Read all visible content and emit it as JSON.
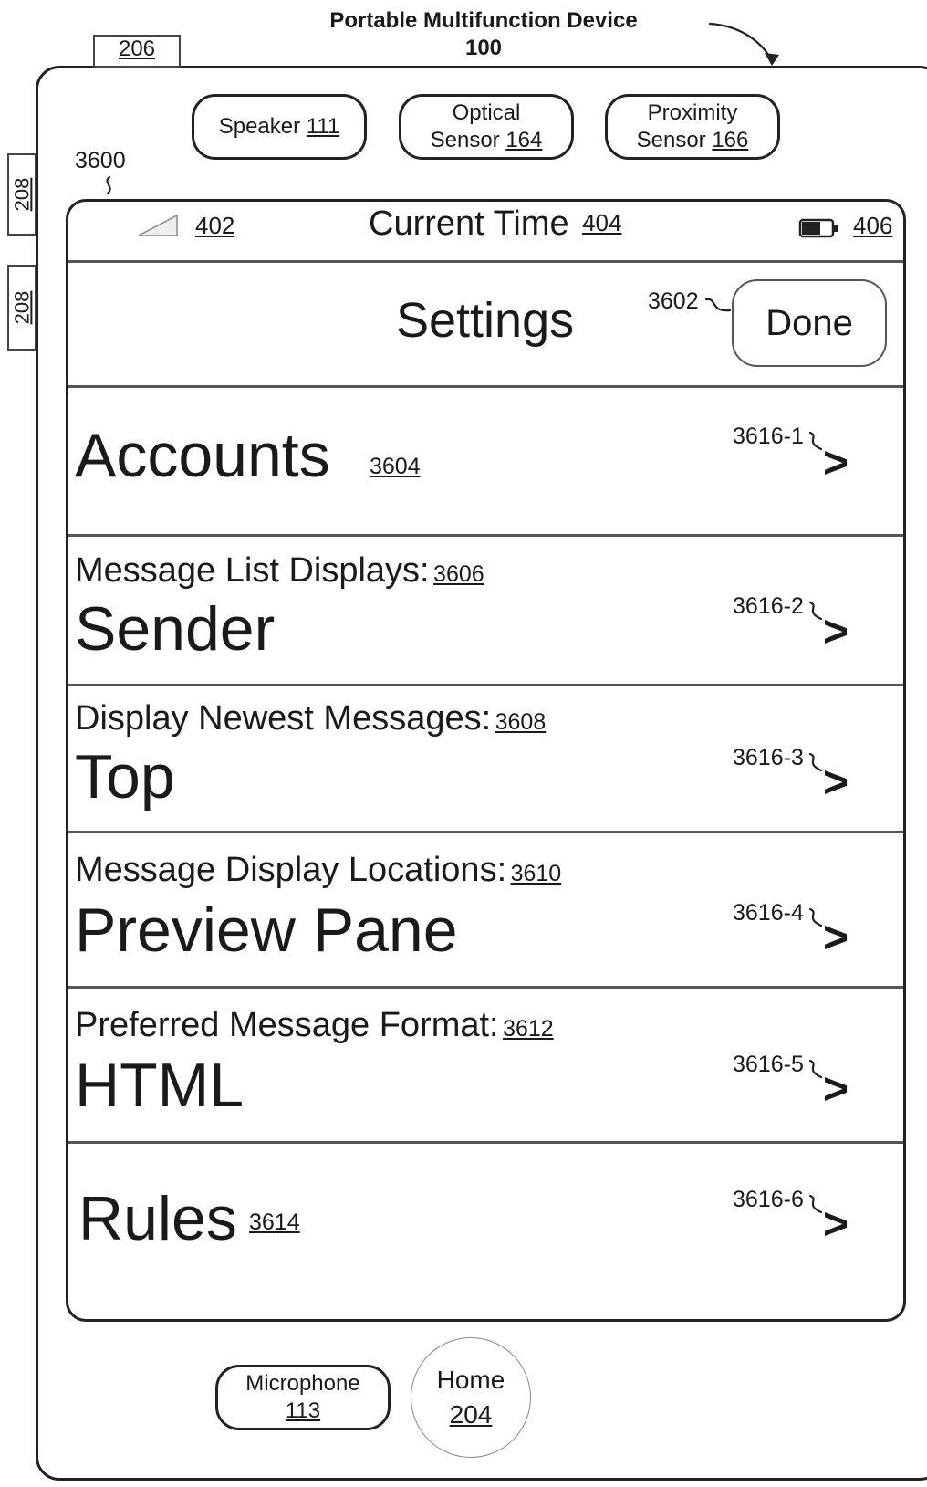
{
  "figure": {
    "title": "Portable Multifunction Device",
    "number": "100",
    "screen_ref": "3600"
  },
  "side_refs": [
    "206",
    "208",
    "208"
  ],
  "hardware": {
    "speaker": {
      "label": "Speaker",
      "ref": "111"
    },
    "optical": {
      "line1": "Optical",
      "label": "Sensor",
      "ref": "164"
    },
    "proximity": {
      "line1": "Proximity",
      "label": "Sensor",
      "ref": "166"
    },
    "microphone": {
      "label": "Microphone",
      "ref": "113"
    },
    "home": {
      "label": "Home",
      "ref": "204"
    }
  },
  "status_bar": {
    "signal_ref": "402",
    "time_label": "Current Time",
    "time_ref": "404",
    "battery_ref": "406"
  },
  "header": {
    "title": "Settings",
    "done_label": "Done",
    "done_ref": "3602"
  },
  "rows": [
    {
      "value": "Accounts",
      "ref": "3604",
      "chevron_ref": "3616-1"
    },
    {
      "label": "Message List Displays:",
      "ref": "3606",
      "value": "Sender",
      "chevron_ref": "3616-2"
    },
    {
      "label": "Display Newest Messages:",
      "ref": "3608",
      "value": "Top",
      "chevron_ref": "3616-3"
    },
    {
      "label": "Message Display Locations:",
      "ref": "3610",
      "value": "Preview Pane",
      "chevron_ref": "3616-4"
    },
    {
      "label": "Preferred Message Format:",
      "ref": "3612",
      "value": "HTML",
      "chevron_ref": "3616-5"
    },
    {
      "value": "Rules",
      "ref": "3614",
      "chevron_ref": "3616-6"
    }
  ],
  "chevron_glyph": ">",
  "colors": {
    "line": "#222222",
    "background": "#ffffff"
  }
}
